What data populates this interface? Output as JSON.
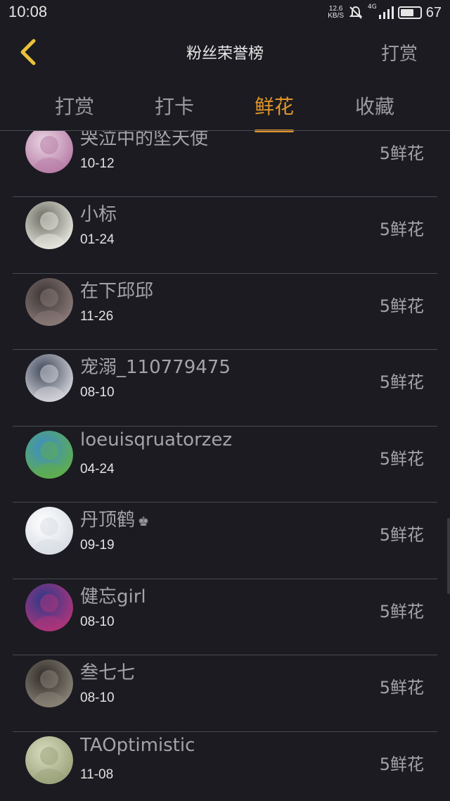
{
  "status_bar": {
    "time": "10:08",
    "net_speed_value": "12.6",
    "net_speed_unit": "KB/S",
    "network": "4G",
    "battery": "67",
    "icons": [
      "mute-bell-icon",
      "signal-icon",
      "battery-icon"
    ]
  },
  "header": {
    "title": "粉丝荣誉榜",
    "right_action": "打赏",
    "back_icon": "chevron-left-icon"
  },
  "tabs": [
    {
      "label": "打赏",
      "active": false
    },
    {
      "label": "打卡",
      "active": false
    },
    {
      "label": "鲜花",
      "active": true
    },
    {
      "label": "收藏",
      "active": false
    }
  ],
  "colors": {
    "background": "#1b1b21",
    "accent": "#e0962a",
    "divider": "#4a4a52"
  },
  "fans": [
    {
      "name": "哭泣中的坠天使",
      "date": "10-12",
      "amount": "5鲜花",
      "avatar_colors": [
        "#b77ba6",
        "#e9d6e2"
      ]
    },
    {
      "name": "小标",
      "date": "01-24",
      "amount": "5鲜花",
      "avatar_colors": [
        "#e8e8e0",
        "#6a6a60"
      ]
    },
    {
      "name": "在下邱邱",
      "date": "11-26",
      "amount": "5鲜花",
      "avatar_colors": [
        "#8a7a78",
        "#3a3434"
      ]
    },
    {
      "name": "宠溺_110779475",
      "date": "08-10",
      "amount": "5鲜花",
      "avatar_colors": [
        "#d6d6dc",
        "#3c4658"
      ]
    },
    {
      "name": "loeuisqruatorzez",
      "date": "04-24",
      "amount": "5鲜花",
      "avatar_colors": [
        "#5fae4a",
        "#3c8ccc"
      ]
    },
    {
      "name": "丹顶鹤",
      "crown": "♚",
      "date": "09-19",
      "amount": "5鲜花",
      "avatar_colors": [
        "#d8dde3",
        "#ffffff"
      ]
    },
    {
      "name": "健忘girl",
      "date": "08-10",
      "amount": "5鲜花",
      "avatar_colors": [
        "#b2347a",
        "#2a3a8a"
      ]
    },
    {
      "name": "叁七七",
      "date": "08-10",
      "amount": "5鲜花",
      "avatar_colors": [
        "#8a8478",
        "#2e2a26"
      ]
    },
    {
      "name": "TAOptimistic",
      "date": "11-08",
      "amount": "5鲜花",
      "avatar_colors": [
        "#9aa27a",
        "#d8dcc0"
      ]
    }
  ]
}
